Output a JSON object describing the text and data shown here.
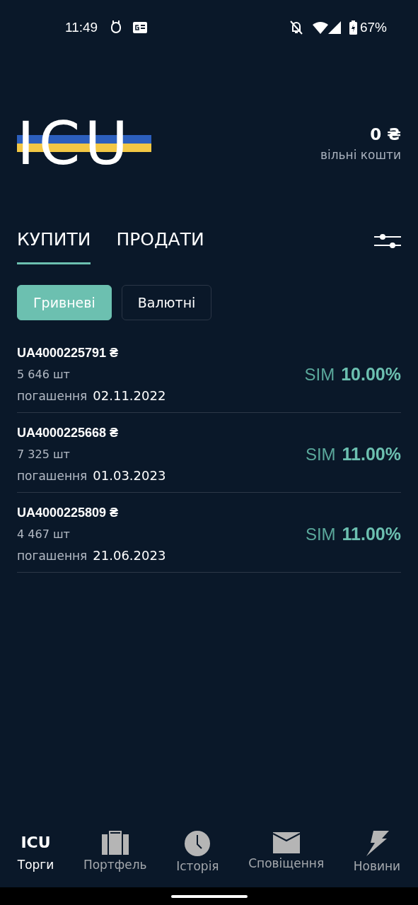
{
  "status_bar": {
    "time": "11:49",
    "battery": "67%"
  },
  "header": {
    "logo": "ICU",
    "balance": "0 ₴",
    "balance_label": "вільні кошти"
  },
  "tabs": [
    {
      "label": "КУПИТИ",
      "selected": true
    },
    {
      "label": "ПРОДАТИ",
      "selected": false
    }
  ],
  "segments": [
    {
      "label": "Гривневі",
      "selected": true
    },
    {
      "label": "Валютні",
      "selected": false
    }
  ],
  "bonds": [
    {
      "code": "UA4000225791 ₴",
      "quantity": "5 646 шт",
      "maturity_label": "погашення",
      "maturity_date": "02.11.2022",
      "yield_label": "SIM",
      "yield_value": "10.00%"
    },
    {
      "code": "UA4000225668 ₴",
      "quantity": "7 325 шт",
      "maturity_label": "погашення",
      "maturity_date": "01.03.2023",
      "yield_label": "SIM",
      "yield_value": "11.00%"
    },
    {
      "code": "UA4000225809 ₴",
      "quantity": "4 467 шт",
      "maturity_label": "погашення",
      "maturity_date": "21.06.2023",
      "yield_label": "SIM",
      "yield_value": "11.00%"
    }
  ],
  "nav": [
    {
      "kind": "logo",
      "icon_text": "ICU",
      "label": "Торги",
      "selected": true
    },
    {
      "kind": "briefcase",
      "label": "Портфель",
      "selected": false
    },
    {
      "kind": "clock",
      "label": "Історія",
      "selected": false
    },
    {
      "kind": "mail",
      "label": "Сповіщення",
      "selected": false
    },
    {
      "kind": "bolt",
      "label": "Новини",
      "selected": false
    }
  ]
}
